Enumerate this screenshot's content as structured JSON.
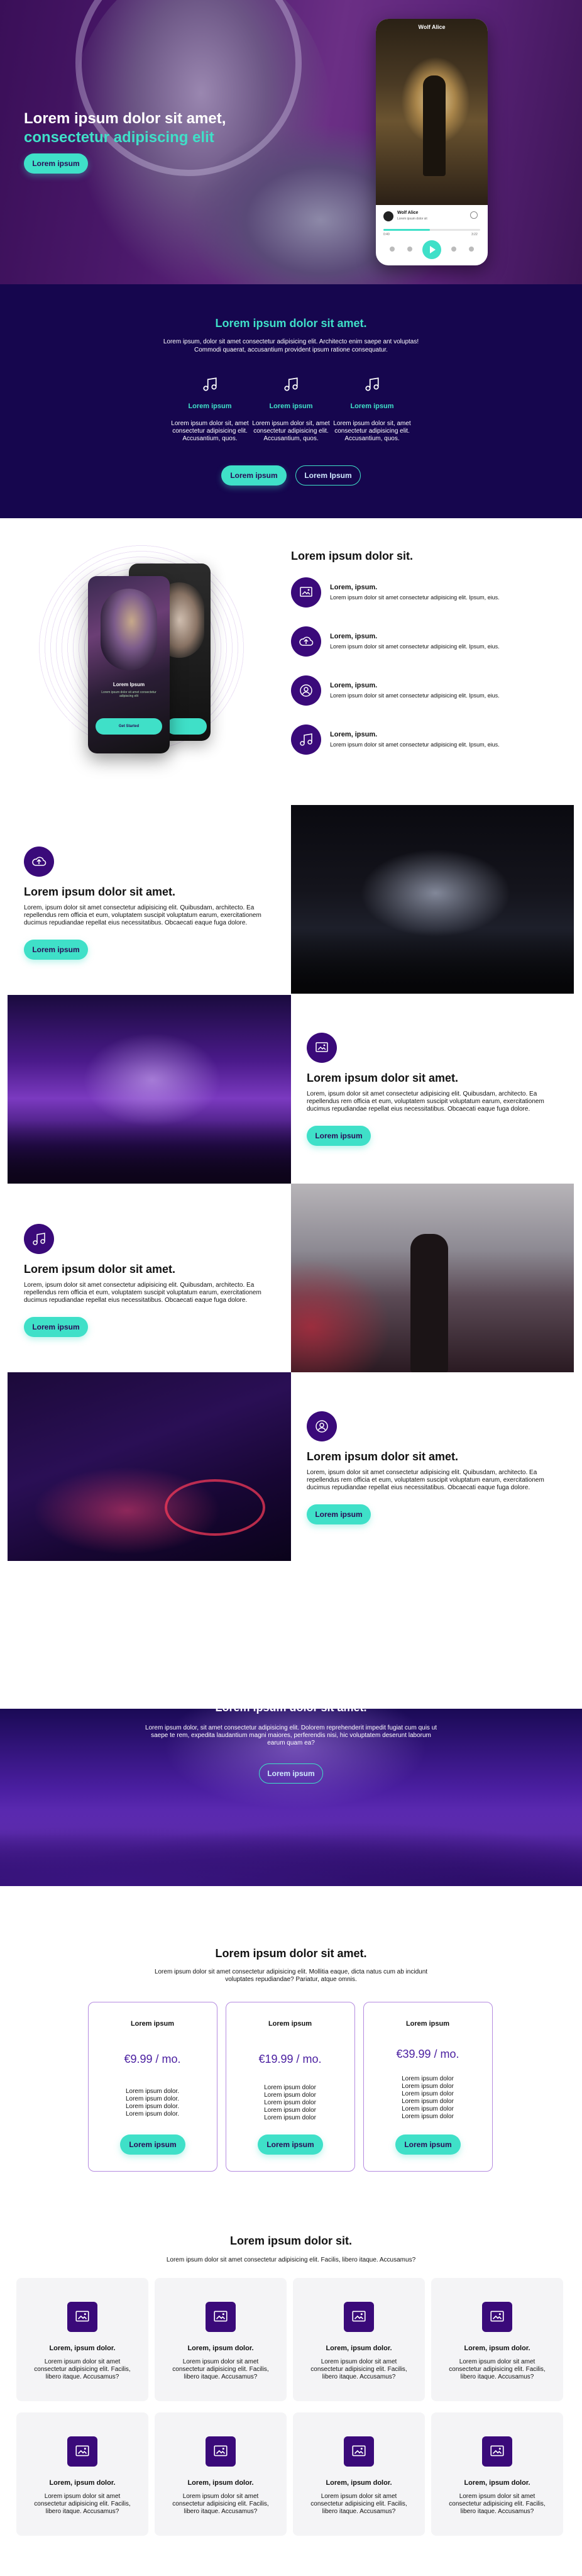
{
  "colors": {
    "accent": "#3fe0c8",
    "deep_purple": "#16064e",
    "icon_purple": "#3a0a7a",
    "price_purple": "#4a1ea0"
  },
  "hero": {
    "title_line1": "Lorem ipsum dolor sit amet,",
    "title_line2": "consectetur adipiscing elit",
    "button": "Lorem ipsum",
    "player": {
      "header": "Wolf Alice",
      "track_title": "Wolf Alice",
      "track_sub": "Lorem ipsum dolor sit",
      "time_start": "0:40",
      "time_end": "3:22"
    }
  },
  "services": {
    "title": "Lorem ipsum dolor sit amet.",
    "desc": "Lorem ipsum, dolor sit amet consectetur adipisicing elit. Architecto enim saepe ant voluptas! Commodi quaerat, accusantium provident ipsum ratione consequatur.",
    "items": [
      {
        "icon": "music-note-icon",
        "title": "Lorem ipsum",
        "text": "Lorem ipsum dolor sit, amet consectetur adipisicing elit. Accusantium, quos."
      },
      {
        "icon": "music-note-icon",
        "title": "Lorem ipsum",
        "text": "Lorem ipsum dolor sit, amet consectetur adipisicing elit. Accusantium, quos."
      },
      {
        "icon": "music-note-icon",
        "title": "Lorem ipsum",
        "text": "Lorem ipsum dolor sit, amet consectetur adipisicing elit. Accusantium, quos."
      }
    ],
    "button_primary": "Lorem ipsum",
    "button_secondary": "Lorem Ipsum"
  },
  "app": {
    "title": "Lorem ipsum dolor sit.",
    "phone_title": "Lorem Ipsum",
    "phone_sub": "Lorem ipsum dolor sit amet consectetur adipiscing elit",
    "phone_button": "Get Started",
    "features": [
      {
        "icon": "image-frame-icon",
        "title": "Lorem, ipsum.",
        "text": "Lorem ipsum dolor sit amet consectetur adipisicing elit. Ipsum, eius."
      },
      {
        "icon": "cloud-upload-icon",
        "title": "Lorem, ipsum.",
        "text": "Lorem ipsum dolor sit amet consectetur adipisicing elit. Ipsum, eius."
      },
      {
        "icon": "user-icon",
        "title": "Lorem, ipsum.",
        "text": "Lorem ipsum dolor sit amet consectetur adipisicing elit. Ipsum, eius."
      },
      {
        "icon": "music-note-icon",
        "title": "Lorem, ipsum.",
        "text": "Lorem ipsum dolor sit amet consectetur adipisicing elit. Ipsum, eius."
      }
    ]
  },
  "alternating": [
    {
      "icon": "cloud-upload-icon",
      "title": "Lorem ipsum dolor sit amet.",
      "text": "Lorem, ipsum dolor sit amet consectetur adipisicing elit. Quibusdam, architecto. Ea repellendus rem officia et eum, voluptatem suscipit voluptatum earum, exercitationem ducimus repudiandae repellat eius necessitatibus. Obcaecati eaque fuga dolore.",
      "button": "Lorem ipsum"
    },
    {
      "icon": "image-frame-icon",
      "title": "Lorem ipsum dolor sit amet.",
      "text": "Lorem, ipsum dolor sit amet consectetur adipisicing elit. Quibusdam, architecto. Ea repellendus rem officia et eum, voluptatem suscipit voluptatum earum, exercitationem ducimus repudiandae repellat eius necessitatibus. Obcaecati eaque fuga dolore.",
      "button": "Lorem ipsum"
    },
    {
      "icon": "music-note-icon",
      "title": "Lorem ipsum dolor sit amet.",
      "text": "Lorem, ipsum dolor sit amet consectetur adipisicing elit. Quibusdam, architecto. Ea repellendus rem officia et eum, voluptatem suscipit voluptatum earum, exercitationem ducimus repudiandae repellat eius necessitatibus. Obcaecati eaque fuga dolore.",
      "button": "Lorem ipsum"
    },
    {
      "icon": "user-icon",
      "title": "Lorem ipsum dolor sit amet.",
      "text": "Lorem, ipsum dolor sit amet consectetur adipisicing elit. Quibusdam, architecto. Ea repellendus rem officia et eum, voluptatem suscipit voluptatum earum, exercitationem ducimus repudiandae repellat eius necessitatibus. Obcaecati eaque fuga dolore.",
      "button": "Lorem ipsum"
    }
  ],
  "cta": {
    "title": "Lorem ipsum dolor sit amet.",
    "desc": "Lorem ipsum dolor, sit amet consectetur adipisicing elit. Dolorem reprehenderit impedit fugiat cum quis ut saepe te rem, expedita laudantium magni maiores, perferendis nisi, hic voluptatem deserunt laborum earum quam ea?",
    "button": "Lorem ipsum"
  },
  "pricing": {
    "title": "Lorem ipsum dolor sit amet.",
    "desc": "Lorem ipsum dolor sit amet consectetur adipisicing elit. Mollitia eaque, dicta natus cum ab incidunt voluptates repudiandae? Pariatur, atque omnis.",
    "plans": [
      {
        "title": "Lorem ipsum",
        "price": "€9.99 / mo.",
        "lines": [
          "Lorem ipsum dolor.",
          "Lorem ipsum dolor.",
          "Lorem ipsum dolor.",
          "Lorem ipsum dolor."
        ],
        "button": "Lorem ipsum"
      },
      {
        "title": "Lorem ipsum",
        "price": "€19.99 / mo.",
        "lines": [
          "Lorem ipsum dolor",
          "Lorem ipsum dolor",
          "Lorem ipsum dolor",
          "Lorem ipsum dolor",
          "Lorem ipsum dolor"
        ],
        "button": "Lorem ipsum"
      },
      {
        "title": "Lorem ipsum",
        "price": "€39.99 / mo.",
        "lines": [
          "Lorem ipsum dolor",
          "Lorem ipsum dolor",
          "Lorem ipsum dolor",
          "Lorem ipsum dolor",
          "Lorem ipsum dolor",
          "Lorem ipsum dolor"
        ],
        "button": "Lorem ipsum"
      }
    ]
  },
  "grid": {
    "title": "Lorem ipsum dolor sit.",
    "desc": "Lorem ipsum dolor sit amet consectetur adipisicing elit. Facilis, libero itaque. Accusamus?",
    "items": [
      {
        "icon": "image-frame-icon",
        "title": "Lorem, ipsum dolor.",
        "text": "Lorem ipsum dolor sit amet consectetur adipisicing elit. Facilis, libero itaque. Accusamus?"
      },
      {
        "icon": "image-frame-icon",
        "title": "Lorem, ipsum dolor.",
        "text": "Lorem ipsum dolor sit amet consectetur adipisicing elit. Facilis, libero itaque. Accusamus?"
      },
      {
        "icon": "image-frame-icon",
        "title": "Lorem, ipsum dolor.",
        "text": "Lorem ipsum dolor sit amet consectetur adipisicing elit. Facilis, libero itaque. Accusamus?"
      },
      {
        "icon": "image-frame-icon",
        "title": "Lorem, ipsum dolor.",
        "text": "Lorem ipsum dolor sit amet consectetur adipisicing elit. Facilis, libero itaque. Accusamus?"
      },
      {
        "icon": "image-frame-icon",
        "title": "Lorem, ipsum dolor.",
        "text": "Lorem ipsum dolor sit amet consectetur adipisicing elit. Facilis, libero itaque. Accusamus?"
      },
      {
        "icon": "image-frame-icon",
        "title": "Lorem, ipsum dolor.",
        "text": "Lorem ipsum dolor sit amet consectetur adipisicing elit. Facilis, libero itaque. Accusamus?"
      },
      {
        "icon": "image-frame-icon",
        "title": "Lorem, ipsum dolor.",
        "text": "Lorem ipsum dolor sit amet consectetur adipisicing elit. Facilis, libero itaque. Accusamus?"
      },
      {
        "icon": "image-frame-icon",
        "title": "Lorem, ipsum dolor.",
        "text": "Lorem ipsum dolor sit amet consectetur adipisicing elit. Facilis, libero itaque. Accusamus?"
      }
    ]
  }
}
